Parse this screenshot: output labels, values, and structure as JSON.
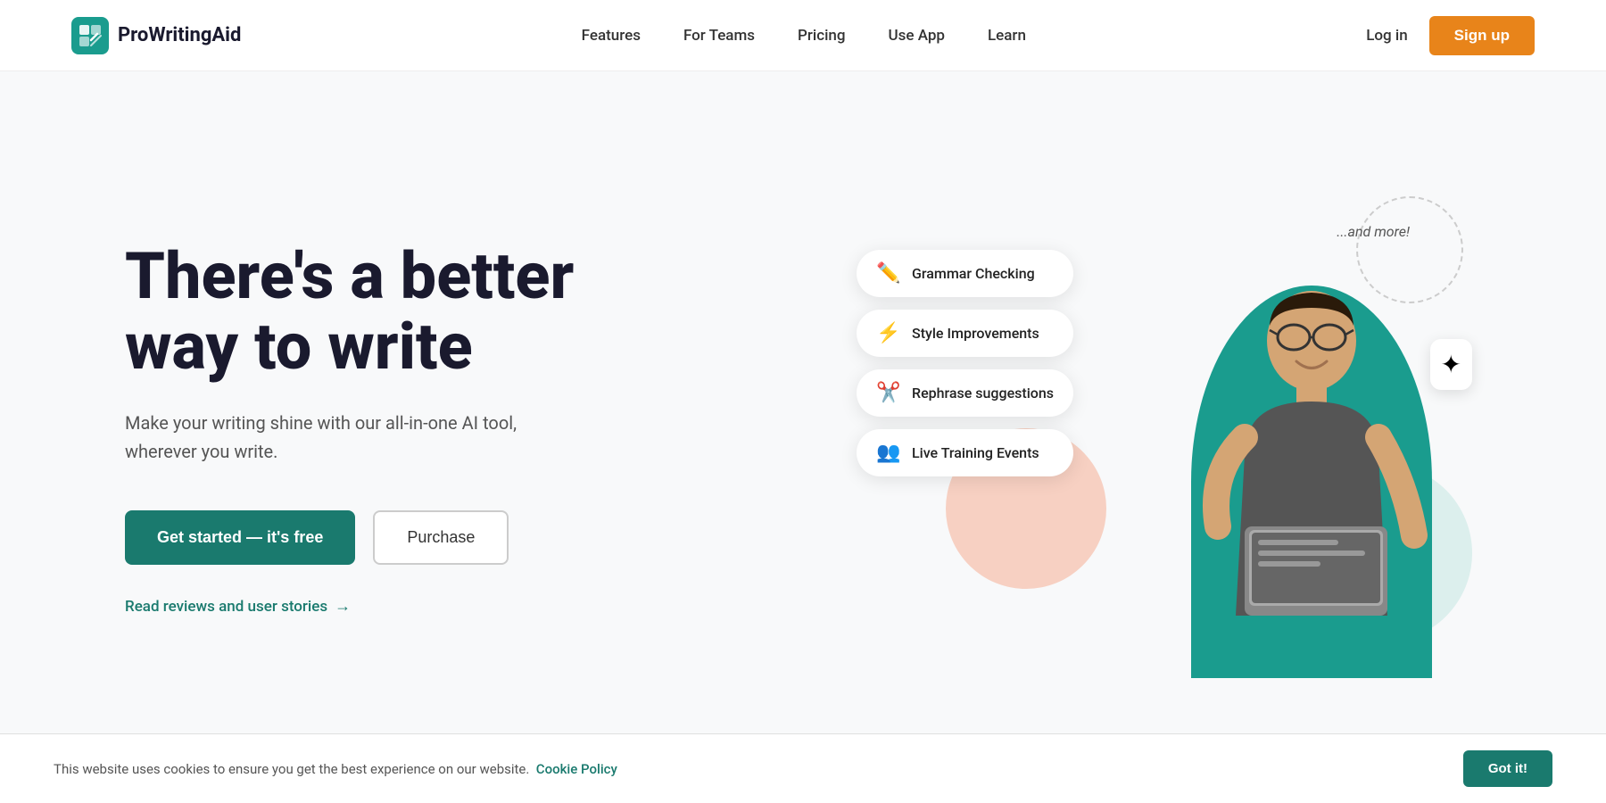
{
  "brand": {
    "name": "ProWritingAid",
    "logo_alt": "ProWritingAid logo"
  },
  "nav": {
    "items": [
      {
        "label": "Features",
        "href": "#"
      },
      {
        "label": "For Teams",
        "href": "#"
      },
      {
        "label": "Pricing",
        "href": "#"
      },
      {
        "label": "Use App",
        "href": "#"
      },
      {
        "label": "Learn",
        "href": "#"
      }
    ],
    "login_label": "Log in",
    "signup_label": "Sign up"
  },
  "hero": {
    "title_line1": "There's a better",
    "title_line2": "way to write",
    "subtitle": "Make your writing shine with our all-in-one AI tool, wherever you write.",
    "cta_primary": "Get started  —  it's free",
    "cta_secondary": "Purchase",
    "review_link": "Read reviews and user stories"
  },
  "features": [
    {
      "icon": "✏️",
      "label": "Grammar Checking"
    },
    {
      "icon": "⚡",
      "label": "Style Improvements"
    },
    {
      "icon": "✂️",
      "label": "Rephrase suggestions"
    },
    {
      "icon": "👥",
      "label": "Live Training Events"
    }
  ],
  "deco": {
    "and_more": "...and more!"
  },
  "cookie": {
    "text": "This website uses cookies to ensure you get the best experience on our website.",
    "link_label": "Cookie Policy",
    "button_label": "Got it!"
  }
}
